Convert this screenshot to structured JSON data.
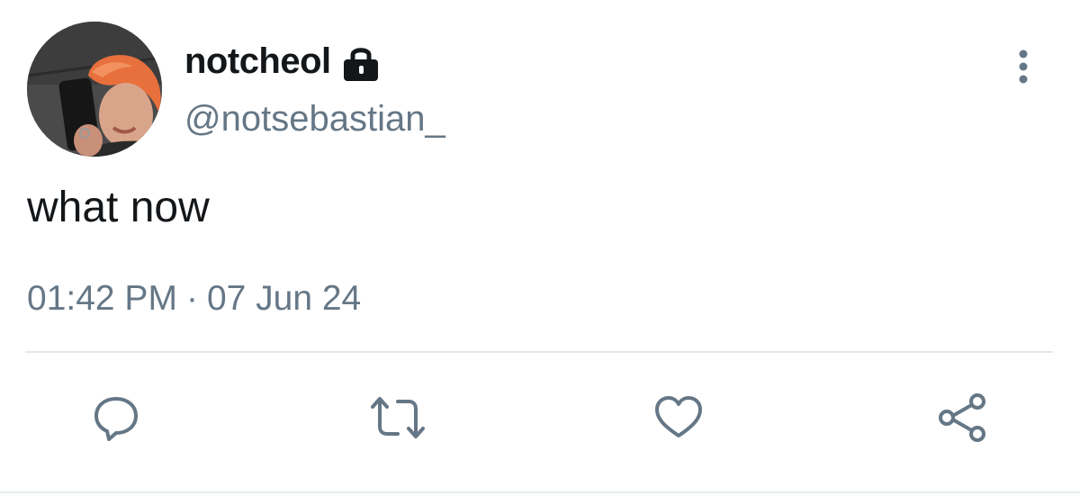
{
  "user": {
    "display_name": "notcheol",
    "handle": "@notsebastian_",
    "avatar": "profile-photo",
    "protected_icon": "lock-icon"
  },
  "tweet": {
    "text": "what now",
    "time": "01:42 PM",
    "separator": "·",
    "date": "07 Jun 24"
  },
  "actions": {
    "reply_icon": "reply-icon",
    "retweet_icon": "retweet-icon",
    "like_icon": "heart-icon",
    "share_icon": "share-icon"
  },
  "menu_icon": "more-vertical-icon",
  "colors": {
    "text_primary": "#14171a",
    "text_secondary": "#657786",
    "divider": "#e1e8ed"
  }
}
